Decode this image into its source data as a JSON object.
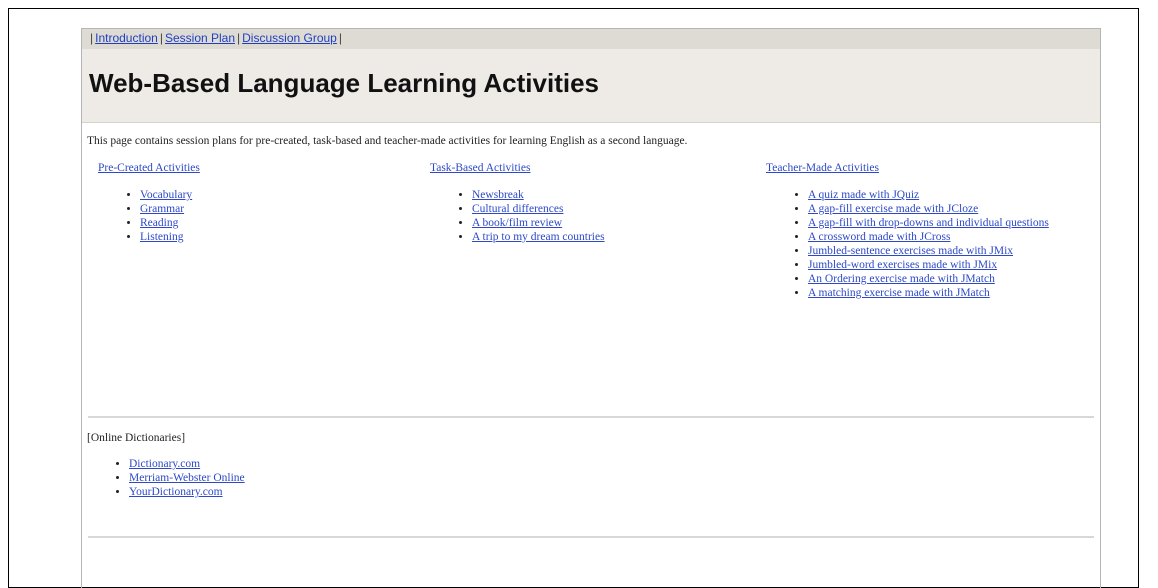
{
  "nav": {
    "sep": "|",
    "items": [
      "Introduction",
      "Session Plan",
      "Discussion Group"
    ]
  },
  "header": {
    "title": "Web-Based Language Learning Activities"
  },
  "intro": "This page contains session plans for pre-created, task-based and teacher-made activities for learning English as a second language.",
  "columns": [
    {
      "heading": "Pre-Created Activities",
      "items": [
        "Vocabulary",
        "Grammar",
        "Reading",
        "Listening"
      ]
    },
    {
      "heading": "Task-Based Activities",
      "items": [
        "Newsbreak",
        "Cultural differences",
        "A book/film review",
        "A trip to my dream countries"
      ]
    },
    {
      "heading": "Teacher-Made Activities",
      "items": [
        "A quiz made with JQuiz",
        "A gap-fill exercise made with JCloze",
        "A gap-fill with drop-downs and individual questions",
        "A crossword made with JCross",
        "Jumbled-sentence exercises made with JMix",
        "Jumbled-word exercises made with JMix",
        "An Ordering exercise made with JMatch",
        "A matching exercise made with JMatch"
      ]
    }
  ],
  "dictionaries": {
    "heading": "[Online Dictionaries]",
    "items": [
      "Dictionary.com",
      "Merriam-Webster Online",
      "YourDictionary.com"
    ]
  }
}
